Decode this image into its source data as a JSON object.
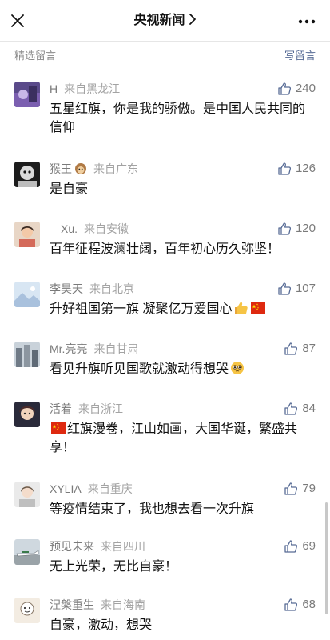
{
  "nav": {
    "title": "央视新闻",
    "close_icon": "close-icon",
    "more_icon": "more-icon"
  },
  "section": {
    "title": "精选留言",
    "write_label": "写留言"
  },
  "colors": {
    "link": "#576b95",
    "muted": "#8a8a8a"
  },
  "comments": [
    {
      "name": "H",
      "location": "来自黑龙江",
      "likes": "240",
      "text": "五星红旗，你是我的骄傲。是中国人民共同的信仰"
    },
    {
      "name": "猴王",
      "location": "来自广东",
      "likes": "126",
      "text": "是自豪"
    },
    {
      "name": "Xu.",
      "location": "来自安徽",
      "likes": "120",
      "text": "百年征程波澜壮阔，百年初心历久弥坚！"
    },
    {
      "name": "李昊天",
      "location": "来自北京",
      "likes": "107",
      "text": "升好祖国第一旗 凝聚亿万爱国心"
    },
    {
      "name": "Mr.亮亮",
      "location": "来自甘肃",
      "likes": "87",
      "text": "看见升旗听见国歌就激动得想哭"
    },
    {
      "name": "活着",
      "location": "来自浙江",
      "likes": "84",
      "text": "红旗漫卷，江山如画，大国华诞，繁盛共享！"
    },
    {
      "name": "XYLIA",
      "location": "来自重庆",
      "likes": "79",
      "text": "等疫情结束了，我也想去看一次升旗"
    },
    {
      "name": "预见未来",
      "location": "来自四川",
      "likes": "69",
      "text": "无上光荣，无比自豪！"
    },
    {
      "name": "涅槃重生",
      "location": "来自海南",
      "likes": "68",
      "text": "自豪，激动，想哭"
    }
  ]
}
